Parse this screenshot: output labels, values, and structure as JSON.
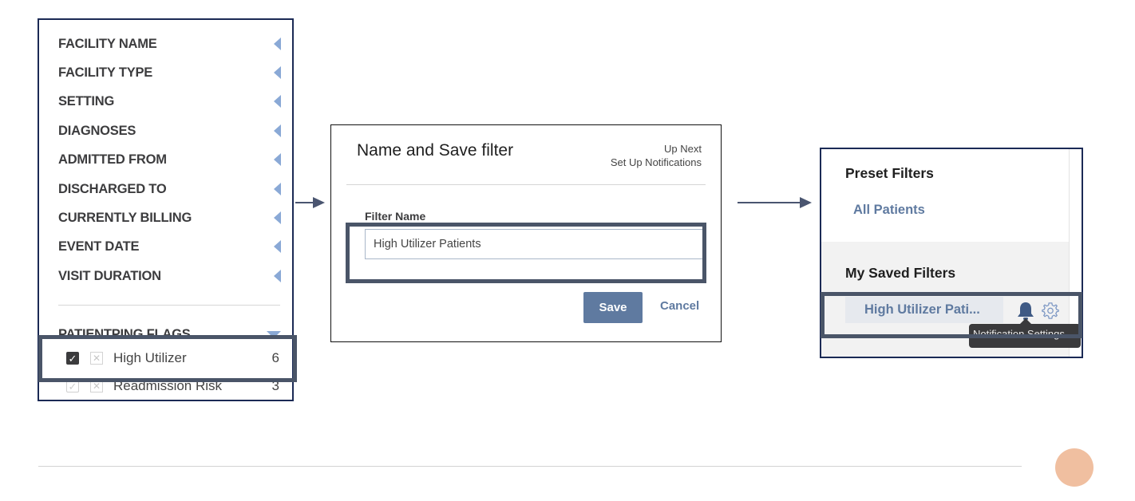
{
  "filter_sidebar": {
    "facets": [
      {
        "label": "FACILITY NAME"
      },
      {
        "label": "FACILITY TYPE"
      },
      {
        "label": "SETTING"
      },
      {
        "label": "DIAGNOSES"
      },
      {
        "label": "ADMITTED FROM"
      },
      {
        "label": "DISCHARGED TO"
      },
      {
        "label": "CURRENTLY BILLING"
      },
      {
        "label": "EVENT DATE"
      },
      {
        "label": "VISIT DURATION"
      }
    ],
    "flags_section": {
      "label": "PATIENTPING FLAGS",
      "items": [
        {
          "label": "High Utilizer",
          "count": "6",
          "checked": true
        },
        {
          "label": "Readmission Risk",
          "count": "3",
          "checked": false
        }
      ]
    }
  },
  "save_modal": {
    "title": "Name and Save filter",
    "up_next_label": "Up Next",
    "up_next_step": "Set Up Notifications",
    "field_label": "Filter Name",
    "field_value": "High Utilizer Patients",
    "save_label": "Save",
    "cancel_label": "Cancel"
  },
  "saved_filters_panel": {
    "preset_heading": "Preset Filters",
    "preset_items": [
      {
        "label": "All Patients"
      }
    ],
    "saved_heading": "My Saved Filters",
    "saved_items": [
      {
        "label": "High Utilizer Pati..."
      }
    ],
    "tooltip": "Notification Settings"
  },
  "colors": {
    "accent": "#5f7aa0",
    "highlight_border": "#4a5568",
    "panel_border": "#1b2a55",
    "caret": "#8aa9d6",
    "footer_dot": "#f0bfa0"
  }
}
